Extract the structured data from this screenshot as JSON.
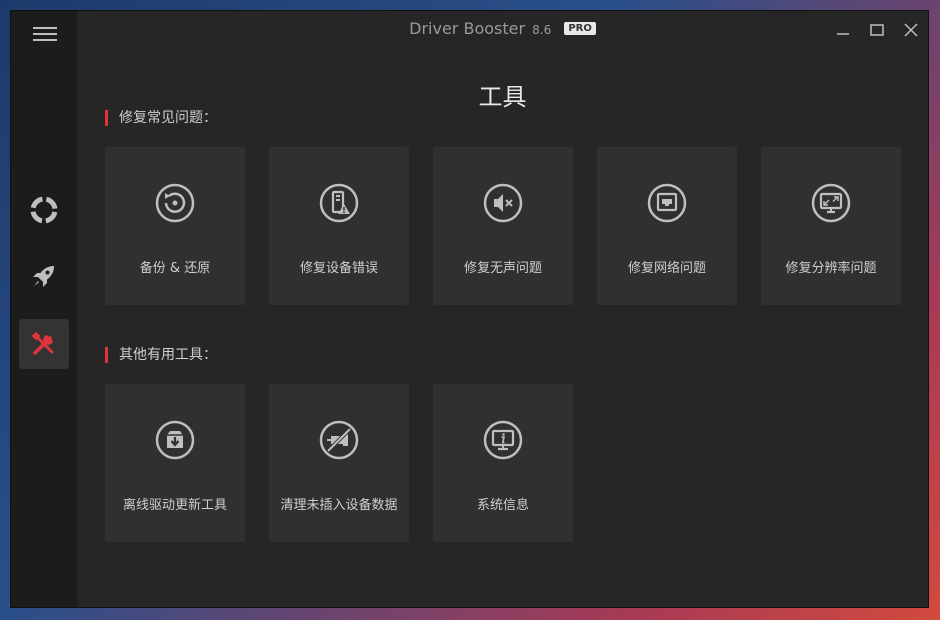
{
  "app": {
    "name": "Driver Booster",
    "version": "8.6",
    "badge": "PRO"
  },
  "page": {
    "title": "工具"
  },
  "sections": [
    {
      "label": "修复常见问题：",
      "tiles": [
        {
          "label": "备份 & 还原",
          "icon": "backup-restore-icon"
        },
        {
          "label": "修复设备错误",
          "icon": "device-error-icon"
        },
        {
          "label": "修复无声问题",
          "icon": "mute-speaker-icon"
        },
        {
          "label": "修复网络问题",
          "icon": "network-icon"
        },
        {
          "label": "修复分辨率问题",
          "icon": "resolution-icon"
        }
      ]
    },
    {
      "label": "其他有用工具：",
      "tiles": [
        {
          "label": "离线驱动更新工具",
          "icon": "offline-update-icon"
        },
        {
          "label": "清理未插入设备数据",
          "icon": "unplugged-device-icon"
        },
        {
          "label": "系统信息",
          "icon": "system-info-icon"
        }
      ]
    }
  ],
  "sidebar": {
    "items": [
      {
        "name": "lifebuoy-icon",
        "active": false
      },
      {
        "name": "rocket-icon",
        "active": false
      },
      {
        "name": "tools-icon",
        "active": true
      }
    ]
  },
  "colors": {
    "accent": "#e2353b",
    "background": "#262626",
    "tile": "#303030",
    "sidebar": "#1c1c1c"
  }
}
